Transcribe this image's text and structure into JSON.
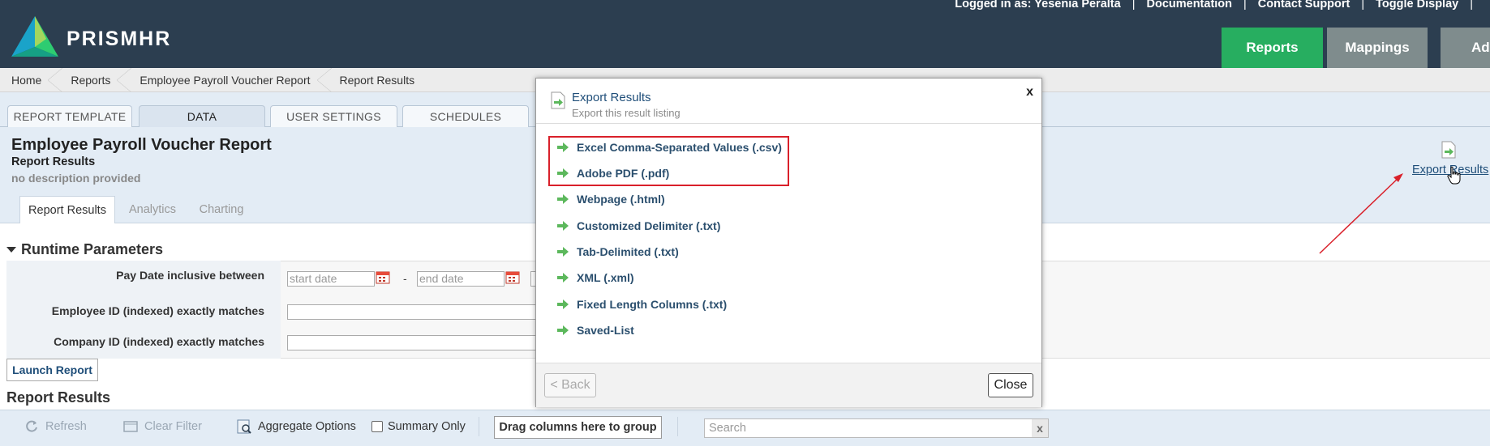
{
  "header": {
    "brand": "PRISMHR",
    "top_links": [
      "Logged in as: Yesenia Peralta",
      "Documentation",
      "Contact Support",
      "Toggle Display"
    ],
    "nav_tabs": [
      {
        "label": "Reports",
        "color": "#27ae60"
      },
      {
        "label": "Mappings",
        "color": "#7f8c8d"
      },
      {
        "label": "Adm",
        "color": "#7f8c8d"
      }
    ]
  },
  "breadcrumb": [
    "Home",
    "Reports",
    "Employee Payroll Voucher Report",
    "Report Results"
  ],
  "report_tabs": [
    "REPORT TEMPLATE",
    "DATA",
    "USER SETTINGS",
    "SCHEDULES"
  ],
  "report": {
    "title": "Employee Payroll Voucher Report",
    "subtitle": "Report Results",
    "description": "no description provided"
  },
  "sub_tabs": [
    "Report Results",
    "Analytics",
    "Charting"
  ],
  "export_link": "Export Results",
  "runtime": {
    "title": "Runtime Parameters",
    "pay_date_label": "Pay Date inclusive between",
    "start_placeholder": "start date",
    "end_placeholder": "end date",
    "date_separator": "-",
    "employee_id_label": "Employee ID (indexed) exactly matches",
    "company_id_label": "Company ID (indexed) exactly matches"
  },
  "launch_button": "Launch Report",
  "results_title": "Report Results",
  "toolbar": {
    "refresh": "Refresh",
    "clear_filter": "Clear Filter",
    "aggregate": "Aggregate Options",
    "summary_only": "Summary Only",
    "group_drop": "Drag columns here to group",
    "search_placeholder": "Search",
    "search_clear": "x"
  },
  "modal": {
    "title": "Export Results",
    "subtitle": "Export this result listing",
    "close_x": "x",
    "options": [
      "Excel Comma-Separated Values (.csv)",
      "Adobe PDF (.pdf)",
      "Webpage (.html)",
      "Customized Delimiter (.txt)",
      "Tab-Delimited (.txt)",
      "XML (.xml)",
      "Fixed Length Columns (.txt)",
      "Saved-List"
    ],
    "back_button": "< Back",
    "close_button": "Close"
  },
  "colors": {
    "header_bg": "#2c3e50",
    "highlight": "#d9202a",
    "link": "#1f4e79"
  }
}
